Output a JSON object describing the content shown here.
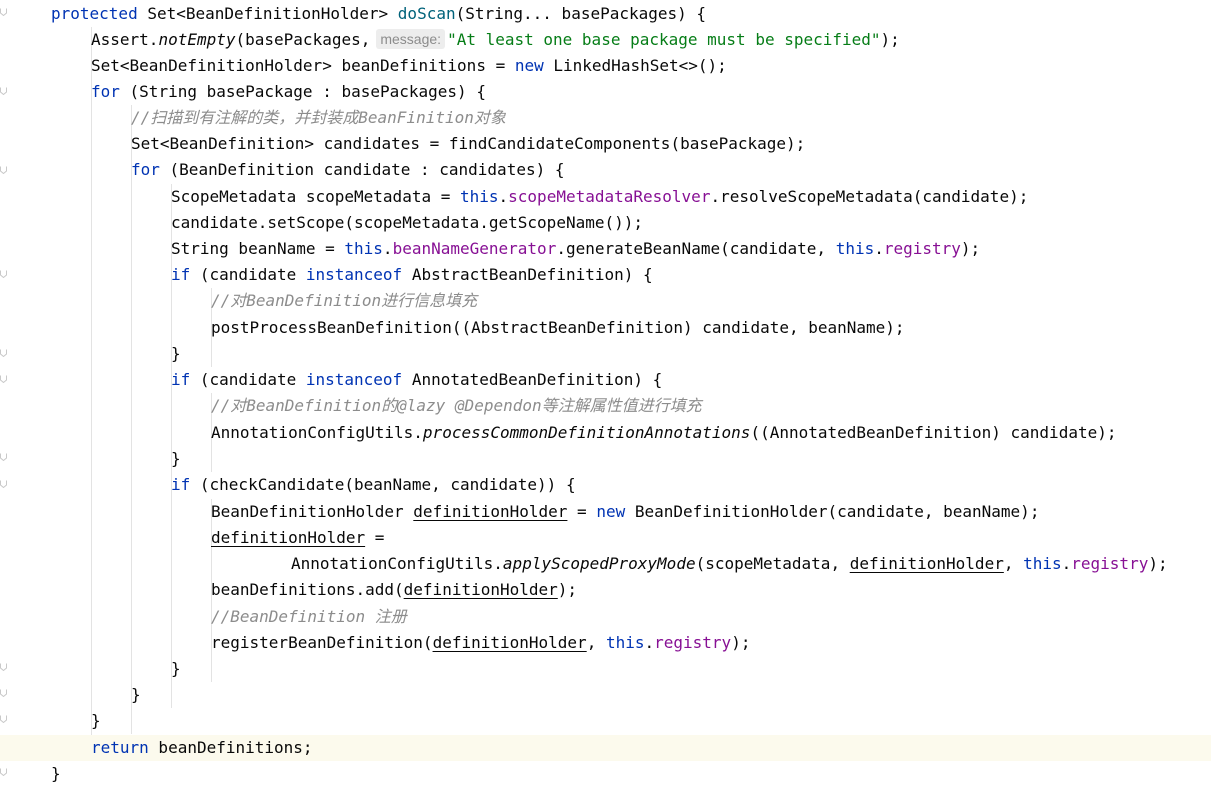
{
  "editor": {
    "method_name": "doScan",
    "param_hint_label": "message:"
  },
  "lines": [
    {
      "id": "l1",
      "tokens": [
        {
          "t": "protected",
          "c": "kw"
        },
        {
          "t": " Set<BeanDefinitionHolder> "
        },
        {
          "t": "doScan",
          "c": "fn"
        },
        {
          "t": "(String... basePackages) {"
        }
      ]
    },
    {
      "id": "l2",
      "tokens": [
        {
          "t": "Assert."
        },
        {
          "t": "notEmpty",
          "c": "static"
        },
        {
          "t": "(basePackages,"
        },
        {
          "hint": "message:"
        },
        {
          "t": "\"At least one base package must be specified\"",
          "c": "str"
        },
        {
          "t": ");"
        }
      ]
    },
    {
      "id": "l3",
      "tokens": [
        {
          "t": "Set<BeanDefinitionHolder> beanDefinitions = "
        },
        {
          "t": "new",
          "c": "kw"
        },
        {
          "t": " LinkedHashSet<>();"
        }
      ]
    },
    {
      "id": "l4",
      "tokens": [
        {
          "t": "for",
          "c": "kw"
        },
        {
          "t": " (String basePackage : basePackages) {"
        }
      ]
    },
    {
      "id": "l5",
      "tokens": [
        {
          "t": "//扫描到有注解的类，并封装成BeanFinition对象",
          "c": "cmt"
        }
      ]
    },
    {
      "id": "l6",
      "tokens": [
        {
          "t": "Set<BeanDefinition> candidates = findCandidateComponents(basePackage);"
        }
      ]
    },
    {
      "id": "l7",
      "tokens": [
        {
          "t": "for",
          "c": "kw"
        },
        {
          "t": " (BeanDefinition candidate : candidates) {"
        }
      ]
    },
    {
      "id": "l8",
      "tokens": [
        {
          "t": "ScopeMetadata scopeMetadata = "
        },
        {
          "t": "this",
          "c": "kw"
        },
        {
          "t": "."
        },
        {
          "t": "scopeMetadataResolver",
          "c": "field"
        },
        {
          "t": ".resolveScopeMetadata(candidate);"
        }
      ]
    },
    {
      "id": "l9",
      "tokens": [
        {
          "t": "candidate.setScope(scopeMetadata.getScopeName());"
        }
      ]
    },
    {
      "id": "l10",
      "tokens": [
        {
          "t": "String beanName = "
        },
        {
          "t": "this",
          "c": "kw"
        },
        {
          "t": "."
        },
        {
          "t": "beanNameGenerator",
          "c": "field"
        },
        {
          "t": ".generateBeanName(candidate, "
        },
        {
          "t": "this",
          "c": "kw"
        },
        {
          "t": "."
        },
        {
          "t": "registry",
          "c": "field"
        },
        {
          "t": ");"
        }
      ]
    },
    {
      "id": "l11",
      "tokens": [
        {
          "t": "if",
          "c": "kw"
        },
        {
          "t": " (candidate "
        },
        {
          "t": "instanceof",
          "c": "kw"
        },
        {
          "t": " AbstractBeanDefinition) {"
        }
      ]
    },
    {
      "id": "l12",
      "tokens": [
        {
          "t": "//对BeanDefinition进行信息填充",
          "c": "cmt"
        }
      ]
    },
    {
      "id": "l13",
      "tokens": [
        {
          "t": "postProcessBeanDefinition((AbstractBeanDefinition) candidate, beanName);"
        }
      ]
    },
    {
      "id": "l14",
      "tokens": [
        {
          "t": "}"
        }
      ]
    },
    {
      "id": "l15",
      "tokens": [
        {
          "t": "if",
          "c": "kw"
        },
        {
          "t": " (candidate "
        },
        {
          "t": "instanceof",
          "c": "kw"
        },
        {
          "t": " AnnotatedBeanDefinition) {"
        }
      ]
    },
    {
      "id": "l16",
      "tokens": [
        {
          "t": "//对BeanDefinition的@lazy @Dependon等注解属性值进行填充",
          "c": "cmt"
        }
      ]
    },
    {
      "id": "l17",
      "tokens": [
        {
          "t": "AnnotationConfigUtils."
        },
        {
          "t": "processCommonDefinitionAnnotations",
          "c": "static"
        },
        {
          "t": "((AnnotatedBeanDefinition) candidate);"
        }
      ]
    },
    {
      "id": "l18",
      "tokens": [
        {
          "t": "}"
        }
      ]
    },
    {
      "id": "l19",
      "tokens": [
        {
          "t": "if",
          "c": "kw"
        },
        {
          "t": " (checkCandidate(beanName, candidate)) {"
        }
      ]
    },
    {
      "id": "l20",
      "tokens": [
        {
          "t": "BeanDefinitionHolder "
        },
        {
          "t": "definitionHolder",
          "c": "uvar"
        },
        {
          "t": " = "
        },
        {
          "t": "new",
          "c": "kw"
        },
        {
          "t": " BeanDefinitionHolder(candidate, beanName);"
        }
      ]
    },
    {
      "id": "l21",
      "tokens": [
        {
          "t": "definitionHolder",
          "c": "uvar"
        },
        {
          "t": " ="
        }
      ]
    },
    {
      "id": "l22",
      "tokens": [
        {
          "t": "AnnotationConfigUtils."
        },
        {
          "t": "applyScopedProxyMode",
          "c": "static"
        },
        {
          "t": "(scopeMetadata, "
        },
        {
          "t": "definitionHolder",
          "c": "uvar"
        },
        {
          "t": ", "
        },
        {
          "t": "this",
          "c": "kw"
        },
        {
          "t": "."
        },
        {
          "t": "registry",
          "c": "field"
        },
        {
          "t": ");"
        }
      ]
    },
    {
      "id": "l23",
      "tokens": [
        {
          "t": "beanDefinitions.add("
        },
        {
          "t": "definitionHolder",
          "c": "uvar"
        },
        {
          "t": ");"
        }
      ]
    },
    {
      "id": "l24",
      "tokens": [
        {
          "t": "//BeanDefinition 注册",
          "c": "cmt"
        }
      ]
    },
    {
      "id": "l25",
      "tokens": [
        {
          "t": "registerBeanDefinition("
        },
        {
          "t": "definitionHolder",
          "c": "uvar"
        },
        {
          "t": ", "
        },
        {
          "t": "this",
          "c": "kw"
        },
        {
          "t": "."
        },
        {
          "t": "registry",
          "c": "field"
        },
        {
          "t": ");"
        }
      ]
    },
    {
      "id": "l26",
      "tokens": [
        {
          "t": "}"
        }
      ]
    },
    {
      "id": "l27",
      "tokens": [
        {
          "t": "}"
        }
      ]
    },
    {
      "id": "l28",
      "tokens": [
        {
          "t": "}"
        }
      ]
    },
    {
      "id": "l29",
      "tokens": [
        {
          "t": "return",
          "c": "kw"
        },
        {
          "t": " beanDefinitions;"
        }
      ]
    },
    {
      "id": "l30",
      "tokens": [
        {
          "t": "}"
        }
      ]
    }
  ]
}
